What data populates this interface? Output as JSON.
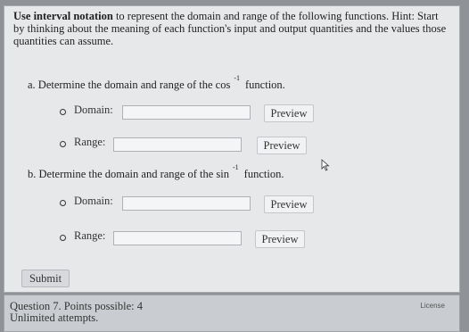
{
  "question": {
    "intro_bold": "Use interval notation",
    "intro_rest": " to represent the domain and range of the following functions. Hint: Start by thinking about the meaning of each function's input and output quantities and the values those quantities can assume.",
    "part_a": {
      "label": "a. Determine the domain and range of the cos",
      "exp": "-1",
      "tail": "function."
    },
    "part_b": {
      "label": "b. Determine the domain and range of the sin",
      "exp": "-1",
      "tail": "function."
    },
    "domain_label": "Domain:",
    "range_label": "Range:",
    "preview_label": "Preview",
    "a_domain_value": "",
    "a_range_value": "",
    "b_domain_value": "",
    "b_range_value": ""
  },
  "submit_label": "Submit",
  "footer": {
    "line1": "Question 7. Points possible: 4",
    "line2": "Unlimited attempts.",
    "license": "License"
  }
}
